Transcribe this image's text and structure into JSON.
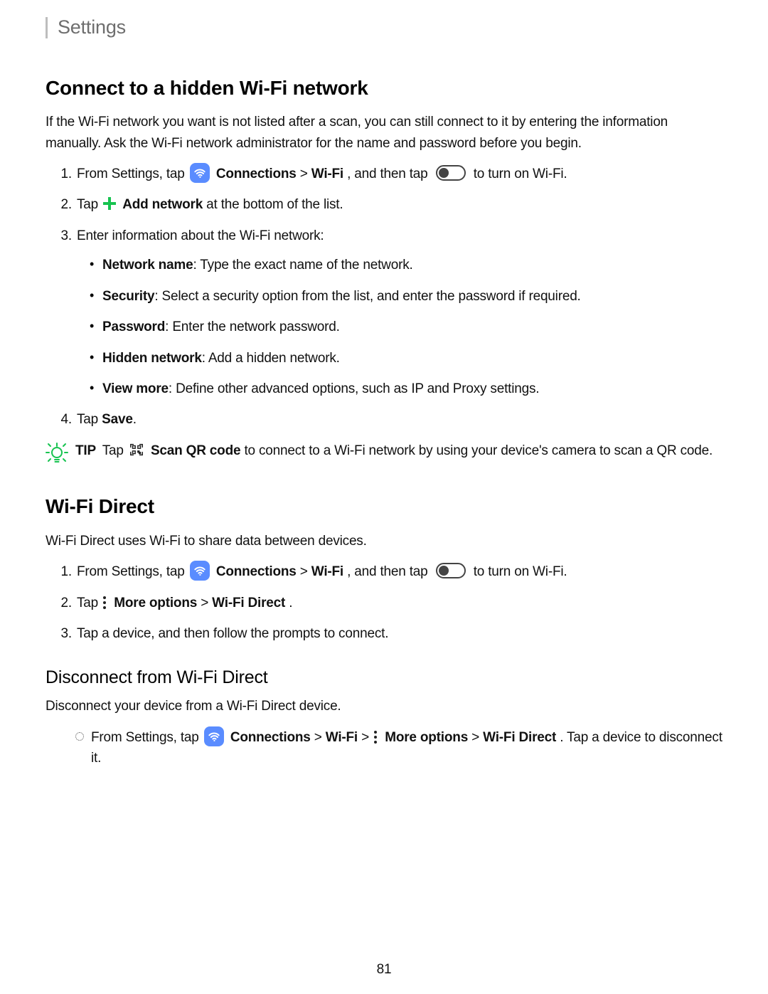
{
  "header": {
    "title": "Settings"
  },
  "page_number": "81",
  "sec1": {
    "heading": "Connect to a hidden Wi-Fi network",
    "intro": "If the Wi-Fi network you want is not listed after a scan, you can still connect to it by entering the information manually. Ask the Wi-Fi network administrator for the name and password before you begin.",
    "step1_a": "From Settings, tap ",
    "step1_b": "Connections",
    "step1_c": " > ",
    "step1_d": "Wi-Fi",
    "step1_e": ", and then tap ",
    "step1_f": " to turn on Wi-Fi.",
    "step2_a": "Tap ",
    "step2_b": "Add network",
    "step2_c": " at the bottom of the list.",
    "step3": "Enter information about the Wi-Fi network:",
    "bullets": {
      "b1_label": "Network name",
      "b1_rest": ": Type the exact name of the network.",
      "b2_label": "Security",
      "b2_rest": ": Select a security option from the list, and enter the password if required.",
      "b3_label": "Password",
      "b3_rest": ": Enter the network password.",
      "b4_label": "Hidden network",
      "b4_rest": ": Add a hidden network.",
      "b5_label": "View more",
      "b5_rest": ": Define other advanced options, such as IP and Proxy settings."
    },
    "step4_a": "Tap ",
    "step4_b": "Save",
    "step4_c": ".",
    "tip_label": "TIP",
    "tip_a": "Tap ",
    "tip_b": "Scan QR code",
    "tip_c": " to connect to a Wi-Fi network by using your device's camera to scan a QR code."
  },
  "sec2": {
    "heading": "Wi-Fi Direct",
    "intro": "Wi-Fi Direct uses Wi-Fi to share data between devices.",
    "step1_a": "From Settings, tap ",
    "step1_b": "Connections",
    "step1_c": " > ",
    "step1_d": "Wi-Fi",
    "step1_e": ", and then tap ",
    "step1_f": " to turn on Wi-Fi.",
    "step2_a": "Tap ",
    "step2_b": "More options",
    "step2_c": " > ",
    "step2_d": "Wi-Fi Direct",
    "step2_e": ".",
    "step3": "Tap a device, and then follow the prompts to connect.",
    "sub_heading": "Disconnect from Wi-Fi Direct",
    "sub_intro": "Disconnect your device from a Wi-Fi Direct device.",
    "sub_step_a": "From Settings, tap ",
    "sub_step_b": "Connections",
    "sub_step_c": " > ",
    "sub_step_d": "Wi-Fi",
    "sub_step_e": " > ",
    "sub_step_f": "More options",
    "sub_step_g": " > ",
    "sub_step_h": "Wi-Fi Direct",
    "sub_step_i": ". Tap a device to disconnect it."
  }
}
